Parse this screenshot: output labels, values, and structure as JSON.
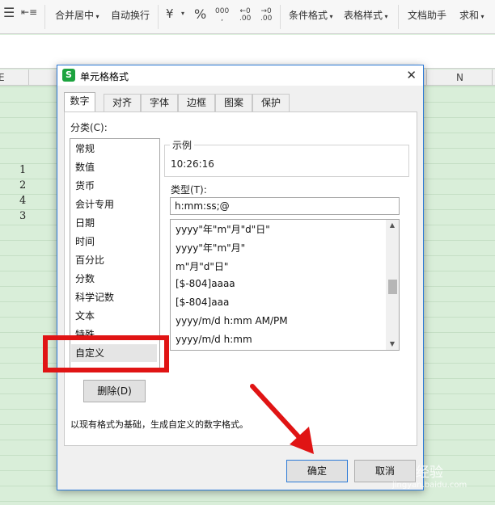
{
  "toolbar": {
    "merge_center": "合并居中",
    "auto_wrap": "自动换行",
    "percent": "%",
    "thousands_top": "000",
    "thousands_bottom": ",",
    "inc_dec_top": "←0",
    "inc_dec_bottom": ".00",
    "dec_dec_top": "→0",
    "dec_dec_bottom": ".00",
    "cond_format": "条件格式",
    "table_style": "表格样式",
    "doc_helper": "文档助手",
    "sum": "求和"
  },
  "sheet": {
    "col_left": "E",
    "col_right": "N",
    "cells": [
      "1",
      "2",
      "4",
      "3"
    ]
  },
  "dialog": {
    "title": "单元格格式",
    "app_icon_letter": "S",
    "tabs": [
      "数字",
      "对齐",
      "字体",
      "边框",
      "图案",
      "保护"
    ],
    "category_label": "分类(C):",
    "categories": [
      "常规",
      "数值",
      "货币",
      "会计专用",
      "日期",
      "时间",
      "百分比",
      "分数",
      "科学记数",
      "文本",
      "特殊",
      "自定义"
    ],
    "selected_category": "自定义",
    "sample_title": "示例",
    "sample_value": "10:26:16",
    "type_label": "类型(T):",
    "type_value": "h:mm:ss;@",
    "formats": [
      "yyyy\"年\"m\"月\"d\"日\"",
      "yyyy\"年\"m\"月\"",
      "m\"月\"d\"日\"",
      "[$-804]aaaa",
      "[$-804]aaa",
      "yyyy/m/d h:mm AM/PM",
      "yyyy/m/d h:mm"
    ],
    "delete_button": "删除(D)",
    "description": "以现有格式为基础，生成自定义的数字格式。",
    "ok_button": "确定",
    "cancel_button": "取消"
  },
  "watermark": {
    "brand": "经验",
    "url": "jingyan.baidu.com"
  },
  "colors": {
    "dialog_border": "#2b79d6",
    "annotation_red": "#e01414",
    "sheet_green": "#d9eed9",
    "app_icon_green": "#1ca33f"
  },
  "icons": [
    "align-icon",
    "indent-icon",
    "merge-center-icon",
    "wrap-icon",
    "currency-icon",
    "dropdown-icon",
    "close-icon",
    "app-icon"
  ]
}
